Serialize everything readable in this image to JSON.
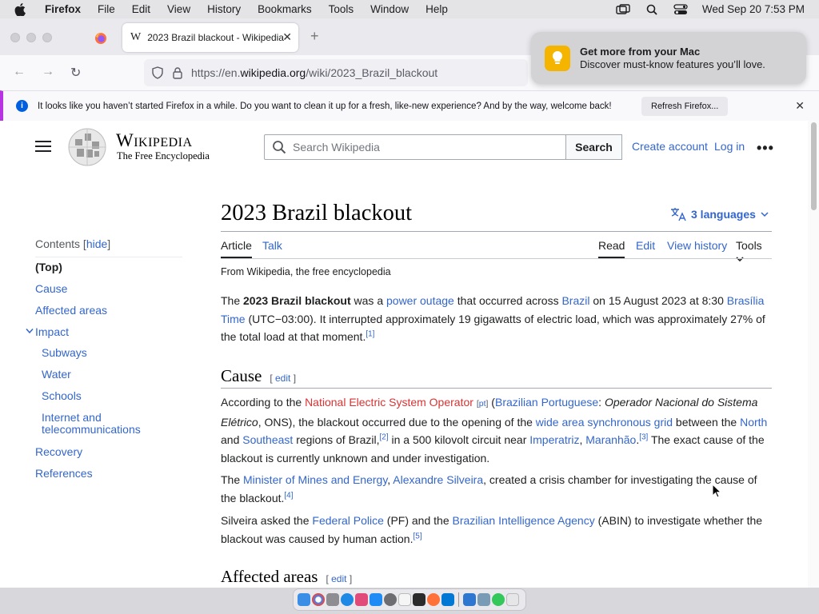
{
  "menubar": {
    "app": "Firefox",
    "items": [
      "File",
      "Edit",
      "View",
      "History",
      "Bookmarks",
      "Tools",
      "Window",
      "Help"
    ],
    "datetime": "Wed Sep 20  7:53 PM"
  },
  "browser": {
    "tab_title": "2023 Brazil blackout - Wikipedia",
    "tab_favicon": "W",
    "url_prefix": "https://en.",
    "url_host": "wikipedia.org",
    "url_path": "/wiki/2023_Brazil_blackout",
    "notice_text": "It looks like you haven’t started Firefox in a while. Do you want to clean it up for a fresh, like-new experience? And by the way, welcome back!",
    "notice_button": "Refresh Firefox..."
  },
  "toast": {
    "title": "Get more from your Mac",
    "body": "Discover must-know features you’ll love."
  },
  "wiki": {
    "wordmark": "Wikipedia",
    "tagline": "The Free Encyclopedia",
    "search_placeholder": "Search Wikipedia",
    "search_button": "Search",
    "create_account": "Create account",
    "log_in": "Log in",
    "more": "•••"
  },
  "toc": {
    "heading": "Contents",
    "hide": "hide",
    "items": {
      "top": "(Top)",
      "cause": "Cause",
      "affected": "Affected areas",
      "impact": "Impact",
      "subways": "Subways",
      "water": "Water",
      "schools": "Schools",
      "internet1": "Internet and",
      "internet2": "telecommunications",
      "recovery": "Recovery",
      "references": "References"
    }
  },
  "article": {
    "title": "2023 Brazil blackout",
    "languages": "3 languages",
    "tabs": {
      "article": "Article",
      "talk": "Talk",
      "read": "Read",
      "edit": "Edit",
      "history": "View history",
      "tools": "Tools"
    },
    "from": "From Wikipedia, the free encyclopedia",
    "h_cause": "Cause",
    "h_affected": "Affected areas",
    "edit_label": "edit"
  },
  "colors": {
    "link": "#3366cc",
    "redlink": "#d73333",
    "accent": "#0060df"
  }
}
